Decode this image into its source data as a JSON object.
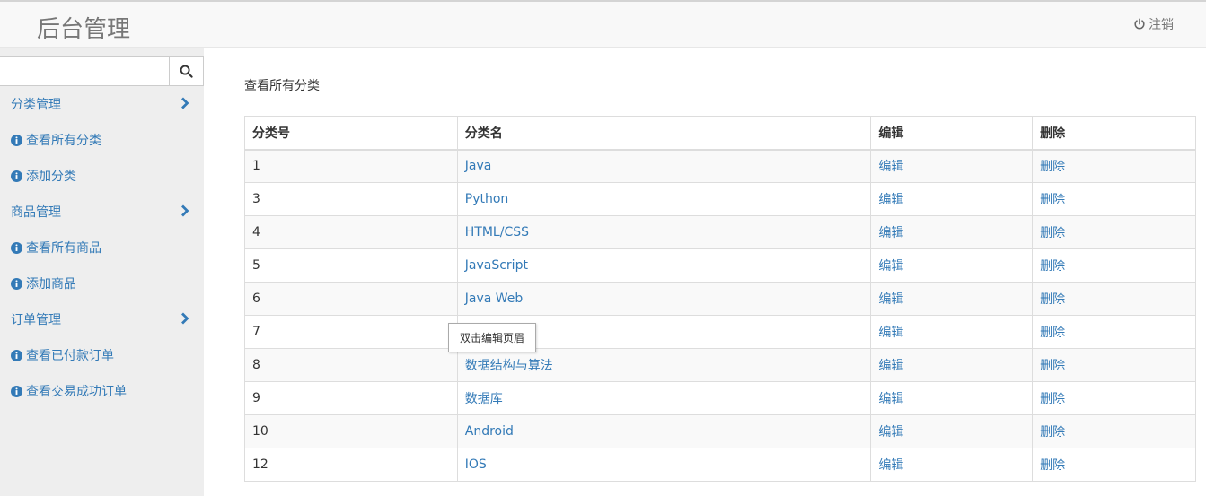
{
  "header": {
    "brand": "后台管理",
    "logout_label": "注销"
  },
  "sidebar": {
    "search": {
      "value": "",
      "placeholder": ""
    },
    "items": [
      {
        "label": "分类管理",
        "type": "group"
      },
      {
        "label": "查看所有分类",
        "type": "link"
      },
      {
        "label": "添加分类",
        "type": "link"
      },
      {
        "label": "商品管理",
        "type": "group"
      },
      {
        "label": "查看所有商品",
        "type": "link"
      },
      {
        "label": "添加商品",
        "type": "link"
      },
      {
        "label": "订单管理",
        "type": "group"
      },
      {
        "label": "查看已付款订单",
        "type": "link"
      },
      {
        "label": "查看交易成功订单",
        "type": "link"
      }
    ]
  },
  "main": {
    "title": "查看所有分类",
    "table": {
      "headers": [
        "分类号",
        "分类名",
        "编辑",
        "删除"
      ],
      "rows": [
        {
          "id": "1",
          "name": "Java",
          "edit": "编辑",
          "delete": "删除"
        },
        {
          "id": "3",
          "name": "Python",
          "edit": "编辑",
          "delete": "删除"
        },
        {
          "id": "4",
          "name": "HTML/CSS",
          "edit": "编辑",
          "delete": "删除"
        },
        {
          "id": "5",
          "name": "JavaScript",
          "edit": "编辑",
          "delete": "删除"
        },
        {
          "id": "6",
          "name": "Java Web",
          "edit": "编辑",
          "delete": "删除"
        },
        {
          "id": "7",
          "name": "",
          "edit": "编辑",
          "delete": "删除"
        },
        {
          "id": "8",
          "name": "数据结构与算法",
          "edit": "编辑",
          "delete": "删除"
        },
        {
          "id": "9",
          "name": "数据库",
          "edit": "编辑",
          "delete": "删除"
        },
        {
          "id": "10",
          "name": "Android",
          "edit": "编辑",
          "delete": "删除"
        },
        {
          "id": "12",
          "name": "IOS",
          "edit": "编辑",
          "delete": "删除"
        }
      ]
    }
  },
  "tooltip": {
    "text": "双击编辑页眉"
  },
  "colors": {
    "link": "#337ab7",
    "sidebar_bg": "#eeeeee",
    "topbar_bg": "#f8f8f8"
  },
  "icons": {
    "logout": "power-icon",
    "search": "search-icon",
    "group": "chevron-right-icon",
    "link": "info-circle-icon"
  }
}
